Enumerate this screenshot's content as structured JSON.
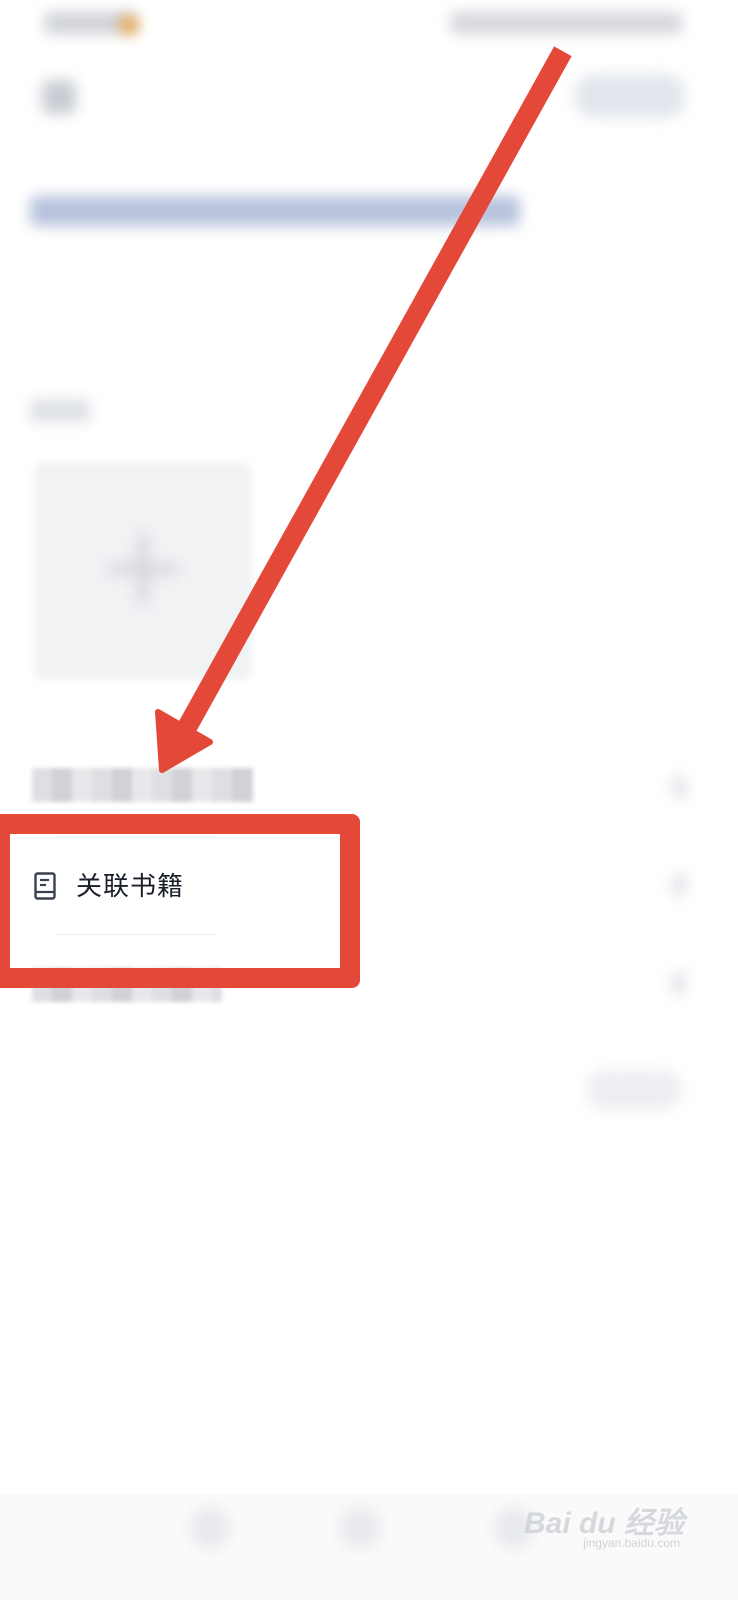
{
  "highlighted_row": {
    "icon": "book-icon",
    "label": "关联书籍"
  },
  "annotation": {
    "arrow_color": "#e34838",
    "box_color": "#e34838"
  },
  "colors": {
    "accent_status_dot": "#f0a238",
    "title_placeholder": "#b7c2dc"
  },
  "watermark": {
    "brand": "Bai du 经验",
    "url": "jingyan.baidu.com"
  }
}
